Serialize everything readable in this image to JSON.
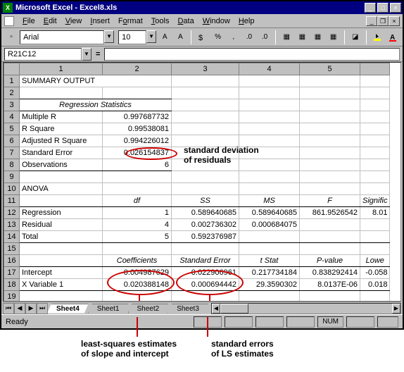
{
  "window": {
    "title": "Microsoft Excel - Excel8.xls"
  },
  "menu": {
    "file": "File",
    "edit": "Edit",
    "view": "View",
    "insert": "Insert",
    "format": "Format",
    "tools": "Tools",
    "data": "Data",
    "window": "Window",
    "help": "Help"
  },
  "toolbar": {
    "font": "Arial",
    "size": "10"
  },
  "namebox": "R21C12",
  "columns": [
    "1",
    "2",
    "3",
    "4",
    "5"
  ],
  "rows": {
    "r1": {
      "c1": "SUMMARY OUTPUT"
    },
    "r3": {
      "c1": "Regression Statistics"
    },
    "r4": {
      "c1": "Multiple R",
      "c2": "0.997687732"
    },
    "r5": {
      "c1": "R Square",
      "c2": "0.99538081"
    },
    "r6": {
      "c1": "Adjusted R Square",
      "c2": "0.994226012"
    },
    "r7": {
      "c1": "Standard Error",
      "c2": "0.026154837"
    },
    "r8": {
      "c1": "Observations",
      "c2": "6"
    },
    "r10": {
      "c1": "ANOVA"
    },
    "r11": {
      "c2": "df",
      "c3": "SS",
      "c4": "MS",
      "c5": "F",
      "c6": "Signific"
    },
    "r12": {
      "c1": "Regression",
      "c2": "1",
      "c3": "0.589640685",
      "c4": "0.589640685",
      "c5": "861.9526542",
      "c6": "8.01"
    },
    "r13": {
      "c1": "Residual",
      "c2": "4",
      "c3": "0.002736302",
      "c4": "0.000684075"
    },
    "r14": {
      "c1": "Total",
      "c2": "5",
      "c3": "0.592376987"
    },
    "r16": {
      "c2": "Coefficients",
      "c3": "Standard Error",
      "c4": "t Stat",
      "c5": "P-value",
      "c6": "Lowe"
    },
    "r17": {
      "c1": "Intercept",
      "c2": "0.004987629",
      "c3": "0.022906961",
      "c4": "0.217734184",
      "c5": "0.838292414",
      "c6": "-0.058"
    },
    "r18": {
      "c1": "X Variable 1",
      "c2": "0.020388148",
      "c3": "0.000694442",
      "c4": "29.3590302",
      "c5": "8.0137E-06",
      "c6": "0.018"
    }
  },
  "annotations": {
    "std_dev": "standard deviation\nof residuals",
    "ls_est": "least-squares estimates\nof slope and intercept",
    "se_ls": "standard errors\nof LS estimates"
  },
  "tabs": {
    "t1": "Sheet4",
    "t2": "Sheet1",
    "t3": "Sheet2",
    "t4": "Sheet3"
  },
  "status": {
    "ready": "Ready",
    "num": "NUM"
  }
}
